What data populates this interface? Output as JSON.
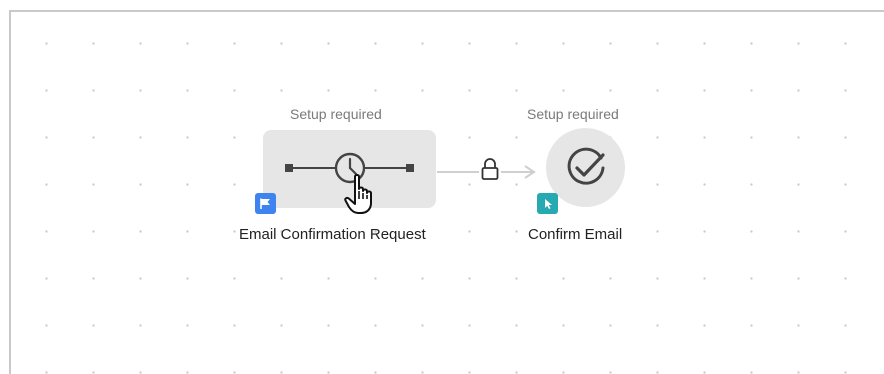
{
  "workflow": {
    "nodes": [
      {
        "id": "email-confirmation-request",
        "status": "Setup required",
        "label": "Email Confirmation Request",
        "icon": "delay-clock-icon",
        "badge_icon": "flag-icon",
        "badge_color": "#3d84f0"
      },
      {
        "id": "confirm-email",
        "status": "Setup required",
        "label": "Confirm Email",
        "icon": "check-circle-icon",
        "badge_icon": "cursor-arrow-icon",
        "badge_color": "#26a9b1"
      }
    ],
    "connector": {
      "icon": "lock-icon"
    }
  },
  "colors": {
    "node_bg": "#e6e6e6",
    "icon_dark": "#444444",
    "status_text": "#7a7a7a",
    "label_text": "#222222",
    "canvas_border": "#c9c9c9"
  }
}
